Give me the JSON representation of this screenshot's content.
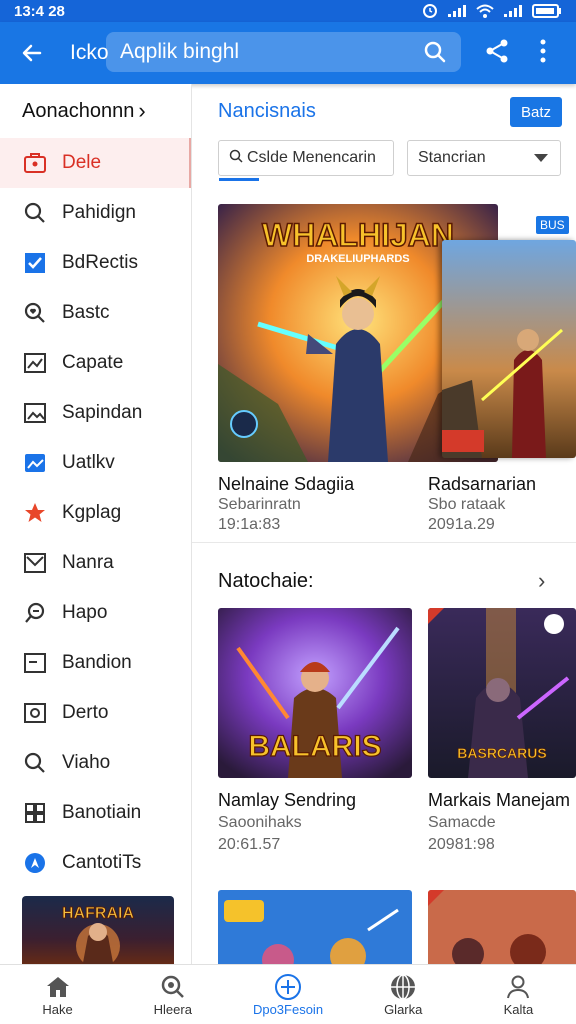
{
  "status": {
    "time": "13:4 28"
  },
  "appbar": {
    "title": "Icko",
    "search_value": "Aqplik binghl",
    "icons": {
      "back": "arrow-back-icon",
      "search": "search-icon",
      "share": "share-icon",
      "more": "more-vert-icon"
    }
  },
  "sidebar": {
    "header": "Aonachonnn",
    "items": [
      {
        "label": "Dele",
        "icon": "briefcase-icon",
        "active": true
      },
      {
        "label": "Pahidign",
        "icon": "search-icon"
      },
      {
        "label": "BdRectis",
        "icon": "checkbox-icon"
      },
      {
        "label": "Bastc",
        "icon": "magnify-heart-icon"
      },
      {
        "label": "Capate",
        "icon": "chart-icon"
      },
      {
        "label": "Sapindan",
        "icon": "image-icon"
      },
      {
        "label": "Uatlkv",
        "icon": "gallery-icon"
      },
      {
        "label": "Kgplag",
        "icon": "star-icon"
      },
      {
        "label": "Nanra",
        "icon": "mail-icon"
      },
      {
        "label": "Hapo",
        "icon": "lasso-icon"
      },
      {
        "label": "Bandion",
        "icon": "window-icon"
      },
      {
        "label": "Derto",
        "icon": "photo-icon"
      },
      {
        "label": "Viaho",
        "icon": "search-icon"
      },
      {
        "label": "Banotiain",
        "icon": "grid-icon"
      },
      {
        "label": "CantotiTs",
        "icon": "compass-icon"
      }
    ],
    "thumb_text": "HAFRAIA"
  },
  "main": {
    "section_title": "Nancisnais",
    "button": "Batz",
    "filter1": "Cslde Menencarin",
    "filter2": "Stancrian",
    "featured": [
      {
        "art_text": "WHALHIJAN",
        "art_sub": "DRAKELIUPHARDS",
        "title": "Nelnaine Sdagiia",
        "sub": "Sebarinratn",
        "meta": "19:1a:83"
      },
      {
        "art_text": "",
        "badge": "BUS",
        "title": "Radsarnarian",
        "sub": "Sbo rataak",
        "meta": "2091a.29"
      }
    ],
    "section2_title": "Natochaie:",
    "grid": [
      {
        "art_text": "BALARIS",
        "title": "Namlay Sendring",
        "sub": "Saoonihaks",
        "meta": "20:61.57"
      },
      {
        "art_text": "BASRCARUS",
        "title": "Markais Manejam",
        "sub": "Samacde",
        "meta": "20981:98"
      }
    ]
  },
  "bottomnav": [
    {
      "label": "Hake",
      "icon": "home-icon"
    },
    {
      "label": "Hleera",
      "icon": "search-circle-icon"
    },
    {
      "label": "Dpo3Fesoin",
      "icon": "add-circle-icon",
      "active": true
    },
    {
      "label": "Glarka",
      "icon": "globe-icon"
    },
    {
      "label": "Kalta",
      "icon": "person-icon"
    }
  ],
  "colors": {
    "primary": "#1976e4",
    "active_red": "#d93025",
    "link_blue": "#1a73e8"
  }
}
